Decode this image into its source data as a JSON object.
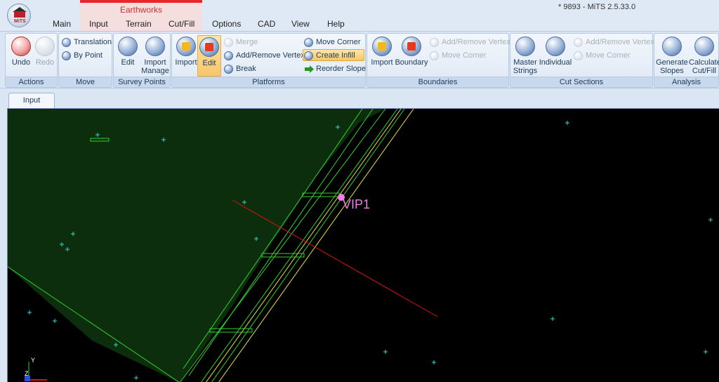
{
  "window": {
    "title": "* 9893 - MiTS 2.5.33.0"
  },
  "logo": {
    "text": "MiTS"
  },
  "context_group": {
    "label": "Earthworks",
    "color": "#e8262b"
  },
  "tabs": [
    {
      "label": "Main"
    },
    {
      "label": "Input"
    },
    {
      "label": "Terrain"
    },
    {
      "label": "Cut/Fill"
    },
    {
      "label": "Options"
    },
    {
      "label": "CAD"
    },
    {
      "label": "View"
    },
    {
      "label": "Help"
    }
  ],
  "ribbon": {
    "actions": {
      "label": "Actions",
      "undo": "Undo",
      "redo": "Redo"
    },
    "move": {
      "label": "Move",
      "translation": "Translation",
      "by_point": "By Point"
    },
    "survey_points": {
      "label": "Survey Points",
      "edit": "Edit",
      "import_manage_1": "Import",
      "import_manage_2": "Manage"
    },
    "platforms": {
      "label": "Platforms",
      "import": "Import",
      "edit": "Edit",
      "merge": "Merge",
      "add_remove_vertex": "Add/Remove Vertex",
      "break": "Break",
      "move_corner": "Move Corner",
      "create_infill": "Create Infill",
      "reorder_slope": "Reorder Slope"
    },
    "boundaries": {
      "label": "Boundaries",
      "import": "Import",
      "boundary": "Boundary",
      "add_remove_vertex": "Add/Remove Vertex",
      "move_corner": "Move Corner"
    },
    "cut_sections": {
      "label": "Cut Sections",
      "master_strings_1": "Master",
      "master_strings_2": "Strings",
      "individual": "Individual",
      "add_remove_vertex": "Add/Remove Vertex",
      "move_corner": "Move Corner"
    },
    "analysis": {
      "label": "Analysis",
      "generate_slopes_1": "Generate",
      "generate_slopes_2": "Slopes",
      "calculate_cutfill_1": "Calculate",
      "calculate_cutfill_2": "Cut/Fill"
    }
  },
  "document": {
    "tab_label": "Input"
  },
  "viewport": {
    "point_label": "VIP1",
    "axis_y": "Y",
    "axis_z": "Z",
    "colors": {
      "background": "#000000",
      "platform": "#0d3a0d",
      "edge": "#2fd02f",
      "boundary": "#e6e04a",
      "section": "#e01010",
      "survey": "#2fd6d6",
      "marker": "#f07ce6"
    }
  }
}
